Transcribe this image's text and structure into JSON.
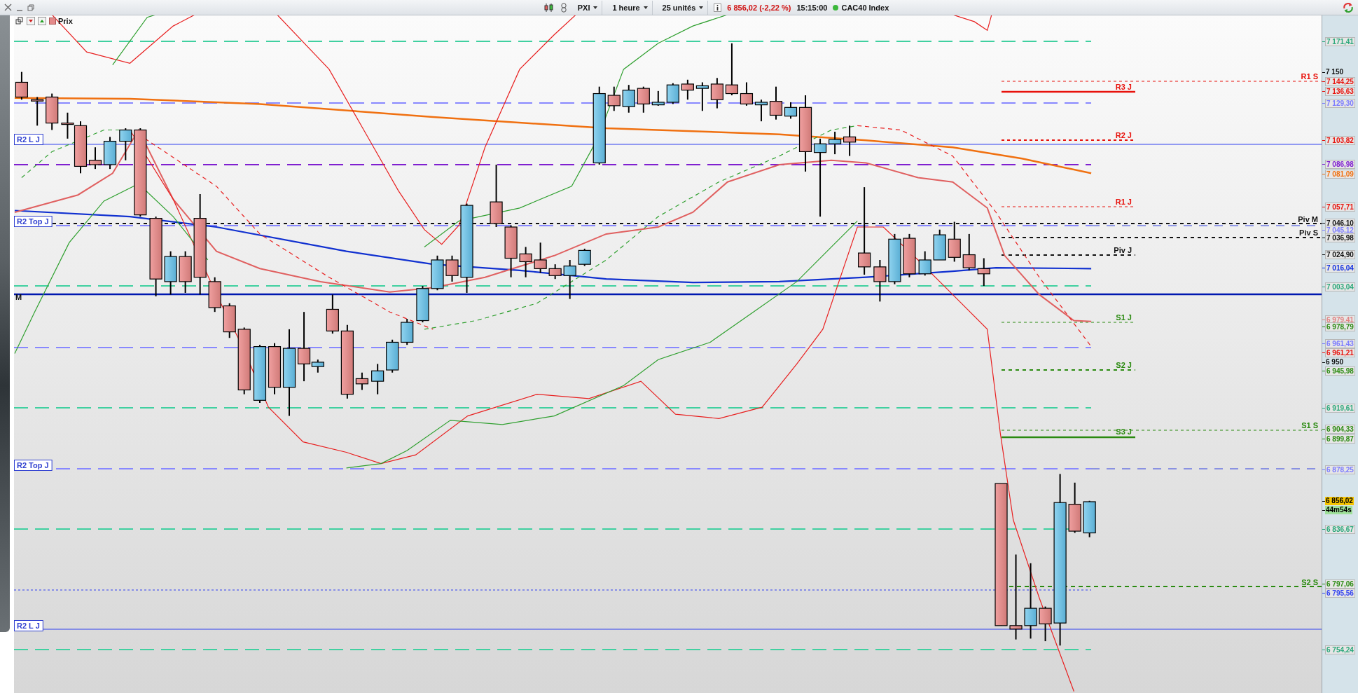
{
  "title_bar": {
    "symbol": "PXI",
    "interval": "1 heure",
    "units": "25 unités",
    "last_price": "6 856,02 (-2,22 %)",
    "time": "15:15:00",
    "instrument": "CAC40 Index"
  },
  "chart_toolbar": {
    "series_label": "Prix"
  },
  "level_labels": [
    {
      "text": "R1 S",
      "color": "#e8120c"
    },
    {
      "text": "R3 J",
      "color": "#e8120c"
    },
    {
      "text": "R2 J",
      "color": "#e8120c"
    },
    {
      "text": "R1 J",
      "color": "#e8120c"
    },
    {
      "text": "Piv M",
      "color": "#111111"
    },
    {
      "text": "Piv S",
      "color": "#111111"
    },
    {
      "text": "Piv J",
      "color": "#111111"
    },
    {
      "text": "S1 J",
      "color": "#2a8a10"
    },
    {
      "text": "S2 J",
      "color": "#2a8a10"
    },
    {
      "text": "S1 S",
      "color": "#2a8a10"
    },
    {
      "text": "S3 J",
      "color": "#2a8a10"
    },
    {
      "text": "S2 S",
      "color": "#2a8a10"
    }
  ],
  "left_labels": [
    {
      "text": "R2 L J",
      "kind": "boxed"
    },
    {
      "text": "R2 Top J",
      "kind": "boxed"
    },
    {
      "text": "M",
      "kind": "plain"
    },
    {
      "text": "R2 Top J",
      "kind": "boxed"
    },
    {
      "text": "R2 L J",
      "kind": "boxed"
    }
  ],
  "axis_labels": [
    {
      "text": "7 171,41",
      "color": "#2aa87a",
      "kind": "tag"
    },
    {
      "text": "7 150",
      "color": "#111111",
      "kind": "tick"
    },
    {
      "text": "7 144,25",
      "color": "#e8120c",
      "kind": "tag"
    },
    {
      "text": "7 136,63",
      "color": "#e8120c",
      "kind": "tag"
    },
    {
      "text": "7 129,30",
      "color": "#7a7aff",
      "kind": "tag"
    },
    {
      "text": "7 103,82",
      "color": "#e8120c",
      "kind": "tag"
    },
    {
      "text": "7 086,98",
      "color": "#8020d0",
      "kind": "tag"
    },
    {
      "text": "7 081,09",
      "color": "#f07010",
      "kind": "tag"
    },
    {
      "text": "7 057,71",
      "color": "#e8120c",
      "kind": "tag"
    },
    {
      "text": "7 046,10",
      "color": "#111111",
      "kind": "tag"
    },
    {
      "text": "7 045,12",
      "color": "#7a7aff",
      "kind": "tag"
    },
    {
      "text": "7 036,98",
      "color": "#111111",
      "kind": "tag"
    },
    {
      "text": "7 024,90",
      "color": "#111111",
      "kind": "tag"
    },
    {
      "text": "7 016,04",
      "color": "#1030e0",
      "kind": "tag"
    },
    {
      "text": "7 003,04",
      "color": "#2aa87a",
      "kind": "tag"
    },
    {
      "text": "6 979,41",
      "color": "#e08080",
      "kind": "tag"
    },
    {
      "text": "6 978,79",
      "color": "#2a8a10",
      "kind": "tag"
    },
    {
      "text": "6 961,43",
      "color": "#7a7aff",
      "kind": "tag"
    },
    {
      "text": "6 961,21",
      "color": "#e8120c",
      "kind": "tag"
    },
    {
      "text": "6 950",
      "color": "#111111",
      "kind": "tick"
    },
    {
      "text": "6 945,98",
      "color": "#2a8a10",
      "kind": "tag"
    },
    {
      "text": "6 919,61",
      "color": "#2aa87a",
      "kind": "tag"
    },
    {
      "text": "6 904,33",
      "color": "#2a8a10",
      "kind": "tag"
    },
    {
      "text": "6 899,87",
      "color": "#2a8a10",
      "kind": "tag"
    },
    {
      "text": "6 878,25",
      "color": "#7a7aff",
      "kind": "tag"
    },
    {
      "text": "6 856,02",
      "kind": "price"
    },
    {
      "text": "44m54s",
      "kind": "timer"
    },
    {
      "text": "6 836,67",
      "color": "#2aa87a",
      "kind": "tag"
    },
    {
      "text": "6 797,06",
      "color": "#2a8a10",
      "kind": "tag"
    },
    {
      "text": "6 795,56",
      "color": "#3040f0",
      "kind": "tag"
    },
    {
      "text": "6 754,24",
      "color": "#2aa87a",
      "kind": "tag"
    }
  ]
}
